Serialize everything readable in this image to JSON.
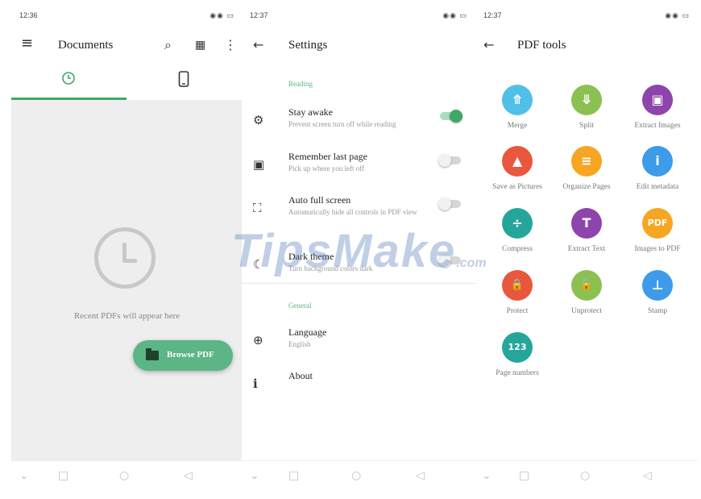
{
  "colors": {
    "accent": "#3ea868",
    "fab": "#5bb584",
    "background": "#eeeeee"
  },
  "documents_screen": {
    "status_time": "12:36",
    "status_icons": "◉◉ ▭",
    "title": "Documents",
    "menu_icon": "≡",
    "search_icon": "⌕",
    "grid_icon": "▦",
    "more_icon": "⋮",
    "tabs": [
      {
        "icon": "clock-icon",
        "selected": true
      },
      {
        "icon": "phone-icon",
        "selected": false
      }
    ],
    "empty_message": "Recent PDFs will appear here",
    "fab_label": "Browse PDF"
  },
  "settings_screen": {
    "status_time": "12:37",
    "status_icons": "◉◉ ▭",
    "title": "Settings",
    "back_icon": "←",
    "sections": [
      {
        "header": "Reading",
        "items": [
          {
            "icon": "⚙",
            "title": "Stay awake",
            "subtitle": "Prevent screen turn off while reading",
            "toggle": true
          },
          {
            "icon": "▣",
            "title": "Remember last page",
            "subtitle": "Pick up where you left off",
            "toggle": false
          },
          {
            "icon": "⛶",
            "title": "Auto full screen",
            "subtitle": "Automatically hide all controls in PDF view",
            "toggle": false
          },
          {
            "icon": "☾",
            "title": "Dark theme",
            "subtitle": "Turn background colors dark",
            "toggle": false
          }
        ]
      },
      {
        "header": "General",
        "items": [
          {
            "icon": "⊕",
            "title": "Language",
            "subtitle": "English"
          },
          {
            "icon": "ℹ",
            "title": "About",
            "subtitle": ""
          }
        ]
      }
    ]
  },
  "pdf_tools_screen": {
    "status_time": "12:37",
    "status_icons": "◉◉ ▭",
    "title": "PDF tools",
    "back_icon": "←",
    "tools": [
      {
        "label": "Merge",
        "color": "#4fc1e9",
        "glyph": "⤊",
        "icon": "merge-icon"
      },
      {
        "label": "Split",
        "color": "#8cc152",
        "glyph": "⤋",
        "icon": "split-icon"
      },
      {
        "label": "Extract Images",
        "color": "#8e44ad",
        "glyph": "▣",
        "icon": "extract-images-icon"
      },
      {
        "label": "Save as Pictures",
        "color": "#e9573f",
        "glyph": "▲",
        "icon": "save-as-pictures-icon"
      },
      {
        "label": "Organize Pages",
        "color": "#f6a623",
        "glyph": "≡",
        "icon": "organize-pages-icon"
      },
      {
        "label": "Edit metadata",
        "color": "#3d9be9",
        "glyph": "i",
        "icon": "edit-metadata-icon"
      },
      {
        "label": "Compress",
        "color": "#26a69a",
        "glyph": "÷",
        "icon": "compress-icon"
      },
      {
        "label": "Extract Text",
        "color": "#8e44ad",
        "glyph": "T",
        "icon": "extract-text-icon"
      },
      {
        "label": "Images to PDF",
        "color": "#f6a623",
        "glyph": "PDF",
        "icon": "images-to-pdf-icon"
      },
      {
        "label": "Protect",
        "color": "#e9573f",
        "glyph": "🔒",
        "icon": "protect-icon"
      },
      {
        "label": "Unprotect",
        "color": "#8cc152",
        "glyph": "🔓",
        "icon": "unprotect-icon"
      },
      {
        "label": "Stamp",
        "color": "#3d9be9",
        "glyph": "⊥",
        "icon": "stamp-icon"
      },
      {
        "label": "Page numbers",
        "color": "#26a69a",
        "glyph": "123",
        "icon": "page-numbers-icon"
      }
    ]
  },
  "nav_bar": {
    "down": "⌄",
    "recents": "□",
    "home": "○",
    "back": "◁"
  },
  "watermark": {
    "text": "TipsMake",
    "suffix": ".com"
  }
}
